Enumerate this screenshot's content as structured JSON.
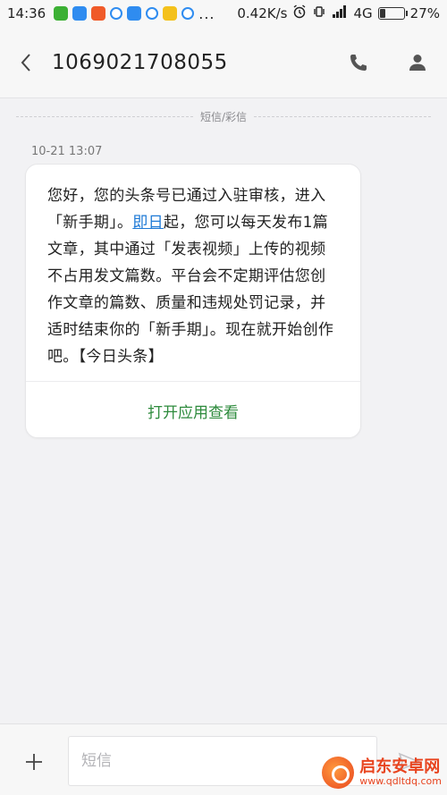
{
  "status_bar": {
    "time": "14:36",
    "speed": "0.42K/s",
    "network": "4G",
    "battery_percent": "27%",
    "battery_level": 0.27,
    "overflow": "..."
  },
  "header": {
    "contact": "1069021708055"
  },
  "thread": {
    "separator_label": "短信/彩信",
    "message_time": "10-21 13:07",
    "message": {
      "part1": "您好，您的头条号已通过入驻审核，进入「新手期」。",
      "link": "即日",
      "part2": "起，您可以每天发布1篇文章，其中通过「发表视频」上传的视频不占用发文篇数。平台会不定期评估您创作文章的篇数、质量和违规处罚记录，并适时结束你的「新手期」。现在就开始创作吧。【今日头条】"
    },
    "action_label": "打开应用查看"
  },
  "composer": {
    "placeholder": "短信"
  },
  "watermark": {
    "title": "启东安卓网",
    "url": "www.qdltdq.com"
  },
  "colors": {
    "accent_green": "#2e8b3d",
    "link_blue": "#1e7ad6",
    "background": "#f2f2f4"
  }
}
